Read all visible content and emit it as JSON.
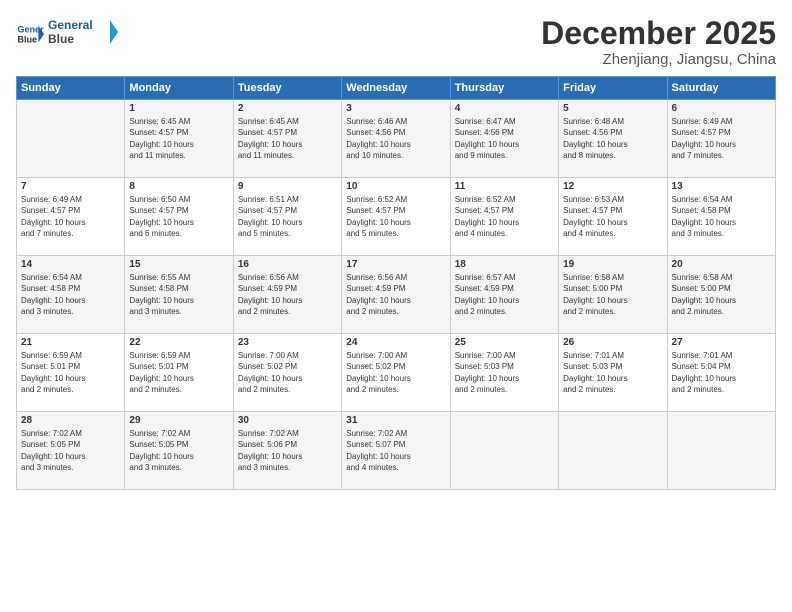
{
  "logo": {
    "line1": "General",
    "line2": "Blue"
  },
  "title": "December 2025",
  "location": "Zhenjiang, Jiangsu, China",
  "days_header": [
    "Sunday",
    "Monday",
    "Tuesday",
    "Wednesday",
    "Thursday",
    "Friday",
    "Saturday"
  ],
  "weeks": [
    [
      {
        "day": "",
        "info": ""
      },
      {
        "day": "1",
        "info": "Sunrise: 6:45 AM\nSunset: 4:57 PM\nDaylight: 10 hours\nand 11 minutes."
      },
      {
        "day": "2",
        "info": "Sunrise: 6:45 AM\nSunset: 4:57 PM\nDaylight: 10 hours\nand 11 minutes."
      },
      {
        "day": "3",
        "info": "Sunrise: 6:46 AM\nSunset: 4:56 PM\nDaylight: 10 hours\nand 10 minutes."
      },
      {
        "day": "4",
        "info": "Sunrise: 6:47 AM\nSunset: 4:56 PM\nDaylight: 10 hours\nand 9 minutes."
      },
      {
        "day": "5",
        "info": "Sunrise: 6:48 AM\nSunset: 4:56 PM\nDaylight: 10 hours\nand 8 minutes."
      },
      {
        "day": "6",
        "info": "Sunrise: 6:49 AM\nSunset: 4:57 PM\nDaylight: 10 hours\nand 7 minutes."
      }
    ],
    [
      {
        "day": "7",
        "info": "Sunrise: 6:49 AM\nSunset: 4:57 PM\nDaylight: 10 hours\nand 7 minutes."
      },
      {
        "day": "8",
        "info": "Sunrise: 6:50 AM\nSunset: 4:57 PM\nDaylight: 10 hours\nand 6 minutes."
      },
      {
        "day": "9",
        "info": "Sunrise: 6:51 AM\nSunset: 4:57 PM\nDaylight: 10 hours\nand 5 minutes."
      },
      {
        "day": "10",
        "info": "Sunrise: 6:52 AM\nSunset: 4:57 PM\nDaylight: 10 hours\nand 5 minutes."
      },
      {
        "day": "11",
        "info": "Sunrise: 6:52 AM\nSunset: 4:57 PM\nDaylight: 10 hours\nand 4 minutes."
      },
      {
        "day": "12",
        "info": "Sunrise: 6:53 AM\nSunset: 4:57 PM\nDaylight: 10 hours\nand 4 minutes."
      },
      {
        "day": "13",
        "info": "Sunrise: 6:54 AM\nSunset: 4:58 PM\nDaylight: 10 hours\nand 3 minutes."
      }
    ],
    [
      {
        "day": "14",
        "info": "Sunrise: 6:54 AM\nSunset: 4:58 PM\nDaylight: 10 hours\nand 3 minutes."
      },
      {
        "day": "15",
        "info": "Sunrise: 6:55 AM\nSunset: 4:58 PM\nDaylight: 10 hours\nand 3 minutes."
      },
      {
        "day": "16",
        "info": "Sunrise: 6:56 AM\nSunset: 4:59 PM\nDaylight: 10 hours\nand 2 minutes."
      },
      {
        "day": "17",
        "info": "Sunrise: 6:56 AM\nSunset: 4:59 PM\nDaylight: 10 hours\nand 2 minutes."
      },
      {
        "day": "18",
        "info": "Sunrise: 6:57 AM\nSunset: 4:59 PM\nDaylight: 10 hours\nand 2 minutes."
      },
      {
        "day": "19",
        "info": "Sunrise: 6:58 AM\nSunset: 5:00 PM\nDaylight: 10 hours\nand 2 minutes."
      },
      {
        "day": "20",
        "info": "Sunrise: 6:58 AM\nSunset: 5:00 PM\nDaylight: 10 hours\nand 2 minutes."
      }
    ],
    [
      {
        "day": "21",
        "info": "Sunrise: 6:59 AM\nSunset: 5:01 PM\nDaylight: 10 hours\nand 2 minutes."
      },
      {
        "day": "22",
        "info": "Sunrise: 6:59 AM\nSunset: 5:01 PM\nDaylight: 10 hours\nand 2 minutes."
      },
      {
        "day": "23",
        "info": "Sunrise: 7:00 AM\nSunset: 5:02 PM\nDaylight: 10 hours\nand 2 minutes."
      },
      {
        "day": "24",
        "info": "Sunrise: 7:00 AM\nSunset: 5:02 PM\nDaylight: 10 hours\nand 2 minutes."
      },
      {
        "day": "25",
        "info": "Sunrise: 7:00 AM\nSunset: 5:03 PM\nDaylight: 10 hours\nand 2 minutes."
      },
      {
        "day": "26",
        "info": "Sunrise: 7:01 AM\nSunset: 5:03 PM\nDaylight: 10 hours\nand 2 minutes."
      },
      {
        "day": "27",
        "info": "Sunrise: 7:01 AM\nSunset: 5:04 PM\nDaylight: 10 hours\nand 2 minutes."
      }
    ],
    [
      {
        "day": "28",
        "info": "Sunrise: 7:02 AM\nSunset: 5:05 PM\nDaylight: 10 hours\nand 3 minutes."
      },
      {
        "day": "29",
        "info": "Sunrise: 7:02 AM\nSunset: 5:05 PM\nDaylight: 10 hours\nand 3 minutes."
      },
      {
        "day": "30",
        "info": "Sunrise: 7:02 AM\nSunset: 5:06 PM\nDaylight: 10 hours\nand 3 minutes."
      },
      {
        "day": "31",
        "info": "Sunrise: 7:02 AM\nSunset: 5:07 PM\nDaylight: 10 hours\nand 4 minutes."
      },
      {
        "day": "",
        "info": ""
      },
      {
        "day": "",
        "info": ""
      },
      {
        "day": "",
        "info": ""
      }
    ]
  ]
}
